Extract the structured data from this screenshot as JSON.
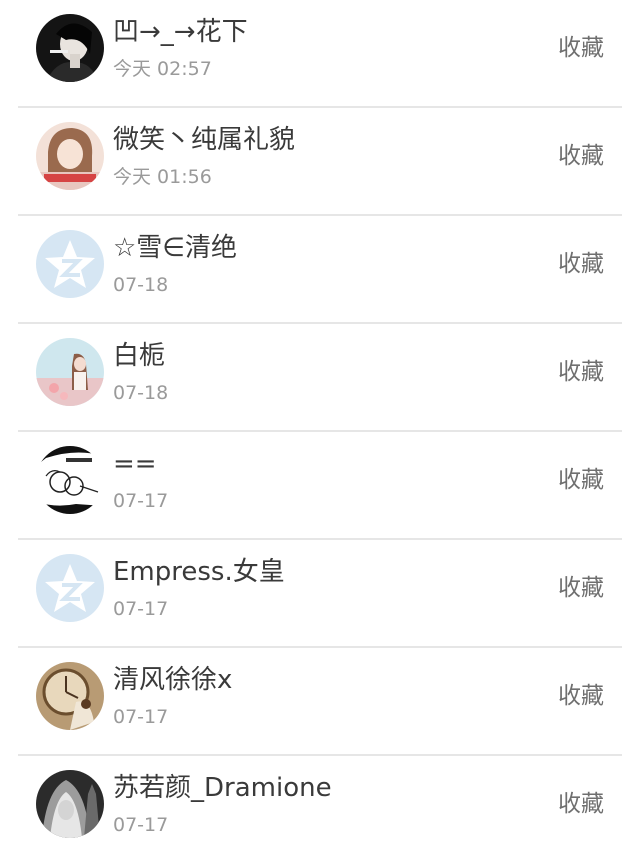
{
  "contacts": [
    {
      "name": "凹→_→花下",
      "time": "今天 02:57",
      "action": "收藏",
      "avatar": "photo-dark-portrait-avatar"
    },
    {
      "name": "微笑丶纯属礼貌",
      "time": "今天 01:56",
      "action": "收藏",
      "avatar": "photo-girl-portrait-avatar"
    },
    {
      "name": "☆雪∈清绝",
      "time": "07-18",
      "action": "收藏",
      "avatar": "qzone-star-default-avatar"
    },
    {
      "name": "白栀",
      "time": "07-18",
      "action": "收藏",
      "avatar": "photo-pastel-girl-avatar"
    },
    {
      "name": "==",
      "time": "07-17",
      "action": "收藏",
      "avatar": "sketch-cartoon-avatar"
    },
    {
      "name": "Empress.女皇",
      "time": "07-17",
      "action": "收藏",
      "avatar": "qzone-star-default-avatar"
    },
    {
      "name": "清风徐徐x",
      "time": "07-17",
      "action": "收藏",
      "avatar": "photo-clock-sepia-avatar"
    },
    {
      "name": "苏若颜_Dramione",
      "time": "07-17",
      "action": "收藏",
      "avatar": "photo-gothic-bw-avatar"
    }
  ],
  "colors": {
    "name_text": "#3a3a3a",
    "time_text": "#9a9a9a",
    "action_text": "#6f6f6f",
    "divider": "#e6e6e6",
    "qzone_avatar_bg": "#d6e6f3"
  }
}
